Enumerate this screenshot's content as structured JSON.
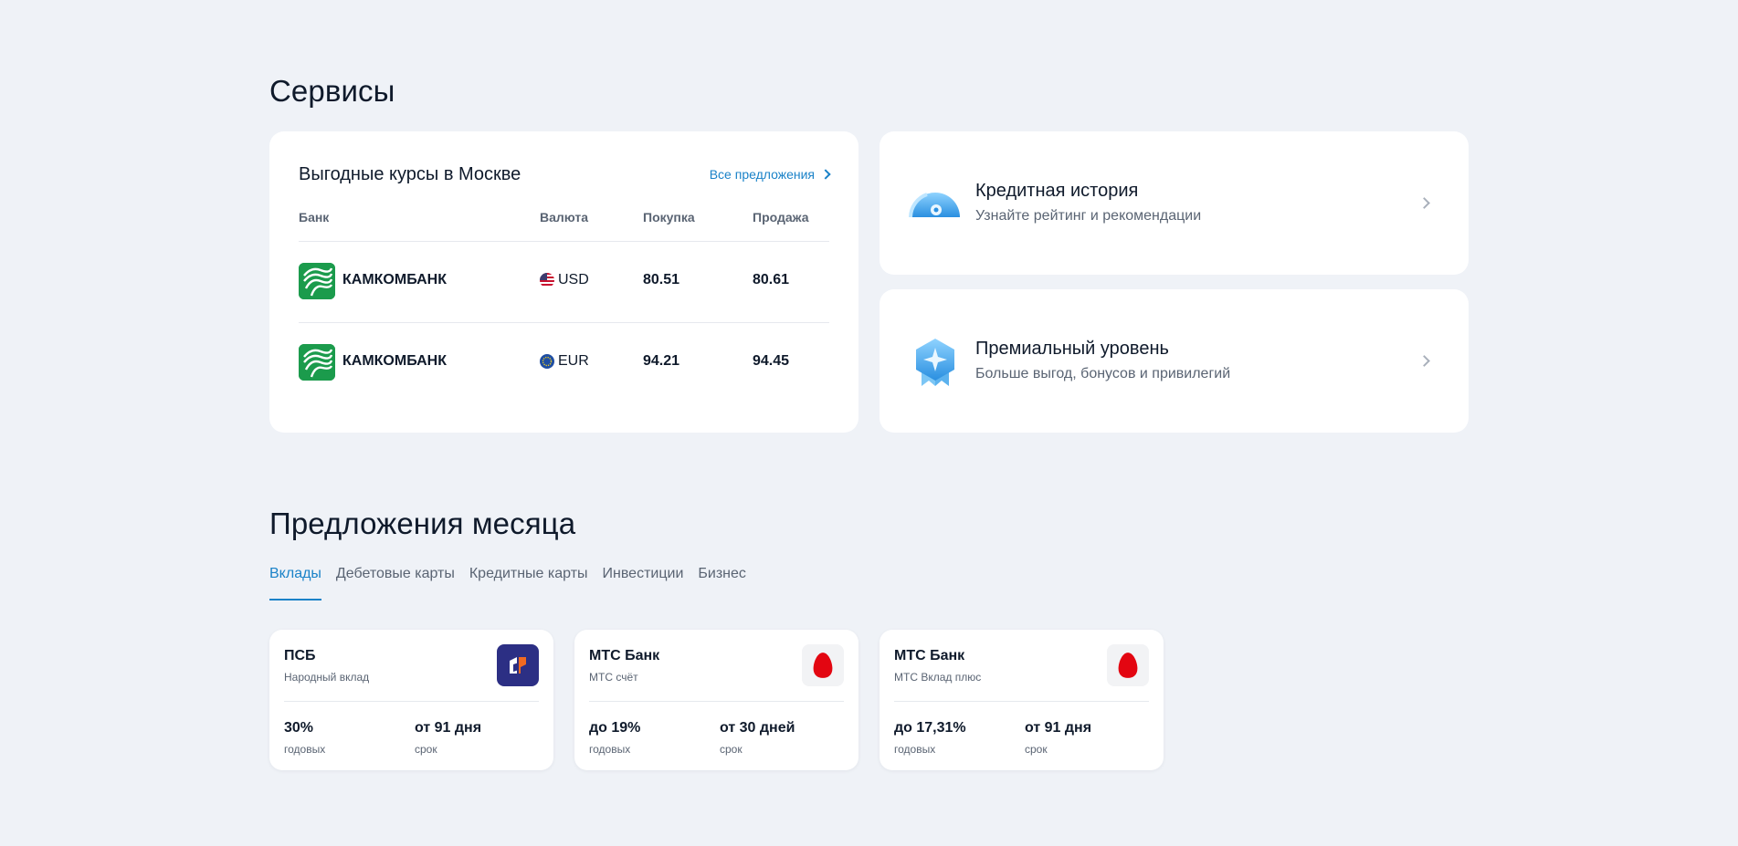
{
  "services": {
    "title": "Сервисы",
    "rates": {
      "title": "Выгодные курсы в Москве",
      "all_link": "Все предложения",
      "headers": {
        "bank": "Банк",
        "currency": "Валюта",
        "buy": "Покупка",
        "sell": "Продажа"
      },
      "rows": [
        {
          "bank": "КАМКОМБАНК",
          "currency": "USD",
          "buy": "80.51",
          "sell": "80.61"
        },
        {
          "bank": "КАМКОМБАНК",
          "currency": "EUR",
          "buy": "94.21",
          "sell": "94.45"
        }
      ]
    },
    "cards": [
      {
        "title": "Кредитная история",
        "subtitle": "Узнайте рейтинг и рекомендации",
        "icon": "speedometer-icon"
      },
      {
        "title": "Премиальный уровень",
        "subtitle": "Больше выгод, бонусов и привилегий",
        "icon": "premium-badge-icon"
      }
    ]
  },
  "offers": {
    "title": "Предложения месяца",
    "tabs": [
      "Вклады",
      "Дебетовые карты",
      "Кредитные карты",
      "Инвестиции",
      "Бизнес"
    ],
    "active_tab": "Вклады",
    "accent_color": "#1a82c8",
    "items": [
      {
        "bank": "ПСБ",
        "product": "Народный вклад",
        "rate": "30%",
        "rate_label": "годовых",
        "term": "от 91 дня",
        "term_label": "срок"
      },
      {
        "bank": "МТС Банк",
        "product": "МТС счёт",
        "rate": "до 19%",
        "rate_label": "годовых",
        "term": "от 30 дней",
        "term_label": "срок"
      },
      {
        "bank": "МТС Банк",
        "product": "МТС Вклад плюс",
        "rate": "до 17,31%",
        "rate_label": "годовых",
        "term": "от 91 дня",
        "term_label": "срок"
      }
    ]
  }
}
